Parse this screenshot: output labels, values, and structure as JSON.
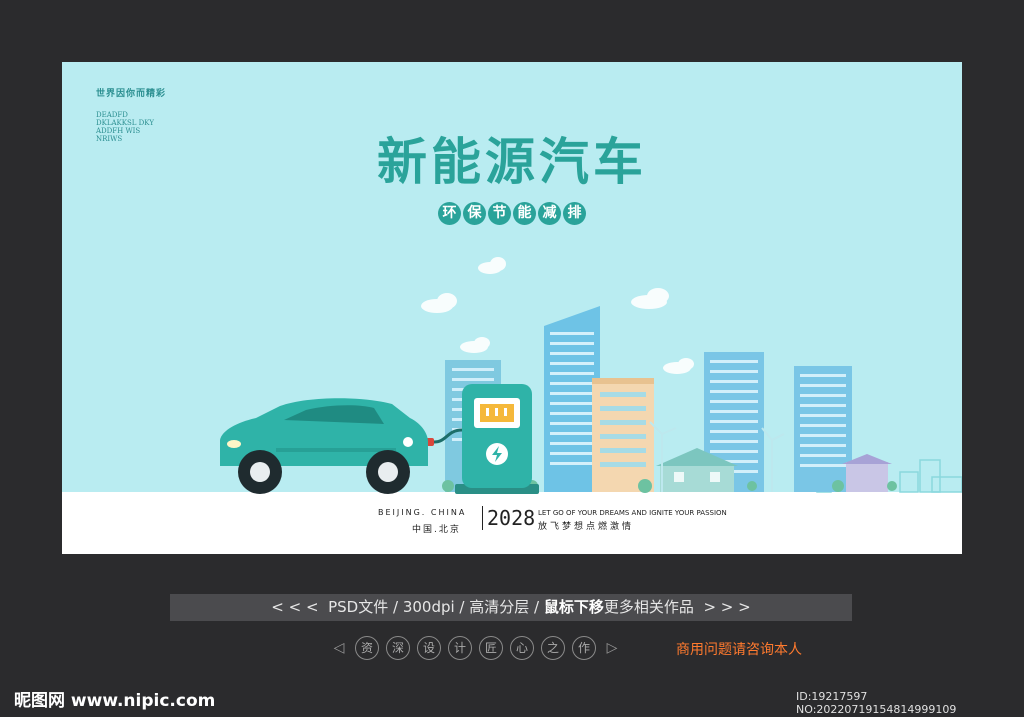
{
  "poster": {
    "corner": {
      "tagline": "世界因你而精彩",
      "lines": [
        "DEADFD",
        "DKLAKKSL DKY",
        "ADDFH WIS",
        "NRIWS"
      ]
    },
    "title": "新能源汽车",
    "subtitle": [
      "环",
      "保",
      "节",
      "能",
      "减",
      "排"
    ],
    "footer": {
      "city_en": "BEIJING. CHINA",
      "city_cn": "中国.北京",
      "year": "2028",
      "slogan_en": "LET GO OF YOUR DREAMS AND IGNITE YOUR PASSION",
      "slogan_cn": "放飞梦想点燃激情"
    },
    "colors": {
      "sky": "#b9ecf1",
      "accent": "#2aa39a",
      "car": "#2fb3a8"
    }
  },
  "info_bar": {
    "left_arrows": "< < <",
    "format": "PSD文件",
    "dpi": "300dpi",
    "layers": "高清分层",
    "mouse_hint": "鼠标下移",
    "more": "更多相关作品",
    "right_arrows": "> > >"
  },
  "badges": {
    "prev": "◁",
    "chars": [
      "资",
      "深",
      "设",
      "计",
      "匠",
      "心",
      "之",
      "作"
    ],
    "next": "▷"
  },
  "contact": "商用问题请咨询本人",
  "brand": "昵图网 www.nipic.com",
  "image_id": "ID:19217597 NO:20220719154814999109"
}
